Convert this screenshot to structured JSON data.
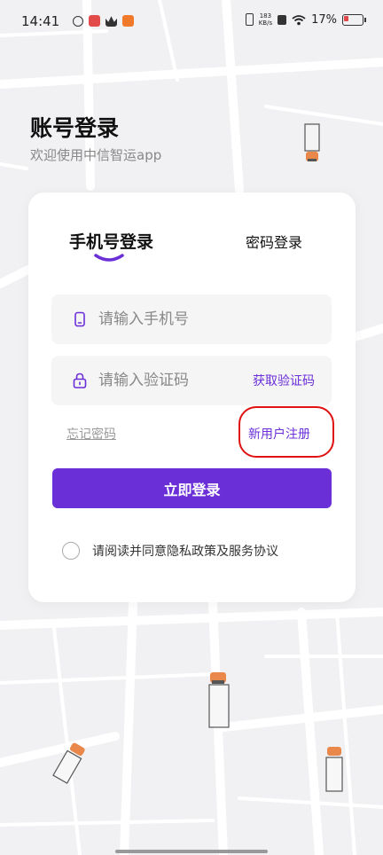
{
  "status_bar": {
    "time": "14:41",
    "net_speed_value": "183",
    "net_speed_unit": "KB/s",
    "battery_percent": "17%"
  },
  "header": {
    "title": "账号登录",
    "subtitle": "欢迎使用中信智运app"
  },
  "login_card": {
    "tabs": [
      {
        "label": "手机号登录",
        "active": true
      },
      {
        "label": "密码登录",
        "active": false
      }
    ],
    "phone_placeholder": "请输入手机号",
    "code_placeholder": "请输入验证码",
    "get_code_label": "获取验证码",
    "forgot_password_label": "忘记密码",
    "register_label": "新用户注册",
    "login_button_label": "立即登录",
    "agreement_text": "请阅读并同意隐私政策及服务协议",
    "agreement_checked": false
  },
  "colors": {
    "accent": "#6b2fd8",
    "annotation_ring": "#e01212",
    "background": "#f1f1f3"
  }
}
